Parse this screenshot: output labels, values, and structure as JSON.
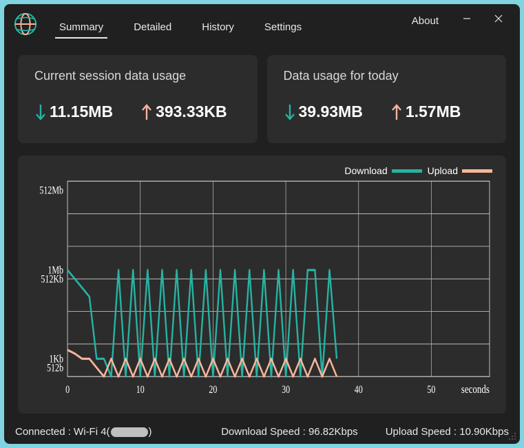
{
  "header": {
    "about": "About",
    "tabs": [
      "Summary",
      "Detailed",
      "History",
      "Settings"
    ],
    "activeTab": 0
  },
  "cards": {
    "session": {
      "title": "Current session data usage",
      "download": "11.15MB",
      "upload": "393.33KB"
    },
    "today": {
      "title": "Data usage for today",
      "download": "39.93MB",
      "upload": "1.57MB"
    }
  },
  "legend": {
    "download": "Download",
    "upload": "Upload"
  },
  "colors": {
    "download": "#26b3a2",
    "upload": "#f8b59a"
  },
  "status": {
    "connection_prefix": "Connected : Wi-Fi 4(",
    "connection_suffix": ")",
    "download_label": "Download Speed : ",
    "download_value": "96.82Kbps",
    "upload_label": "Upload Speed : ",
    "upload_value": "10.90Kbps"
  },
  "chart_data": {
    "type": "line",
    "xlabel": "seconds",
    "ylabel": "",
    "x_ticks": [
      0,
      10,
      20,
      30,
      40,
      50
    ],
    "y_ticks_labels": [
      "512b",
      "1Kb",
      "512Kb",
      "1Mb",
      "512Mb"
    ],
    "y_ticks_values": [
      512,
      1024,
      524288,
      1048576,
      536870912
    ],
    "xlim": [
      0,
      58
    ],
    "y_scale": "log-bytes",
    "series": [
      {
        "name": "Download",
        "color": "#26b3a2",
        "x": [
          0,
          1,
          2,
          3,
          4,
          5,
          6,
          7,
          8,
          9,
          10,
          11,
          12,
          13,
          14,
          15,
          16,
          17,
          18,
          19,
          20,
          21,
          22,
          23,
          24,
          25,
          26,
          27,
          28,
          29,
          30,
          31,
          32,
          33,
          34,
          35,
          36,
          37
        ],
        "values": [
          1048576,
          524288,
          262144,
          131072,
          1024,
          1024,
          0,
          1048576,
          0,
          1048576,
          0,
          1048576,
          0,
          1048576,
          0,
          1048576,
          0,
          1048576,
          0,
          1048576,
          0,
          1048576,
          0,
          1048576,
          0,
          1048576,
          0,
          1048576,
          0,
          1048576,
          0,
          1048576,
          0,
          1048576,
          1048576,
          0,
          1048576,
          1024
        ]
      },
      {
        "name": "Upload",
        "color": "#f8b59a",
        "x": [
          0,
          1,
          2,
          3,
          4,
          5,
          6,
          7,
          8,
          9,
          10,
          11,
          12,
          13,
          14,
          15,
          16,
          17,
          18,
          19,
          20,
          21,
          22,
          23,
          24,
          25,
          26,
          27,
          28,
          29,
          30,
          31,
          32,
          33,
          34,
          35,
          36,
          37
        ],
        "values": [
          2048,
          1536,
          1024,
          1024,
          512,
          0,
          1024,
          0,
          1024,
          0,
          1024,
          0,
          1024,
          0,
          1024,
          0,
          1024,
          0,
          1024,
          0,
          1024,
          0,
          1024,
          0,
          1024,
          0,
          1024,
          0,
          1024,
          0,
          1024,
          0,
          1024,
          0,
          1024,
          0,
          1024,
          0
        ]
      }
    ]
  }
}
